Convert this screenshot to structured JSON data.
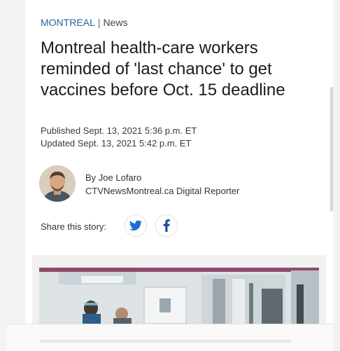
{
  "article": {
    "section": "MONTREAL",
    "separator": "|",
    "category": "News",
    "headline": "Montreal health-care workers reminded of 'last chance' to get vaccines before Oct. 15 deadline",
    "published": "Published Sept. 13, 2021 5:36 p.m. ET",
    "updated": "Updated Sept. 13, 2021 5:42 p.m. ET"
  },
  "author": {
    "byline": "By Joe Lofaro",
    "title": "CTVNewsMontreal.ca Digital Reporter"
  },
  "share": {
    "label": "Share this story:",
    "twitter_icon": "twitter-bird",
    "facebook_icon": "facebook-f"
  },
  "colors": {
    "section_link": "#1f66a8",
    "twitter": "#1d6fd1",
    "facebook": "#1b4f9c"
  }
}
